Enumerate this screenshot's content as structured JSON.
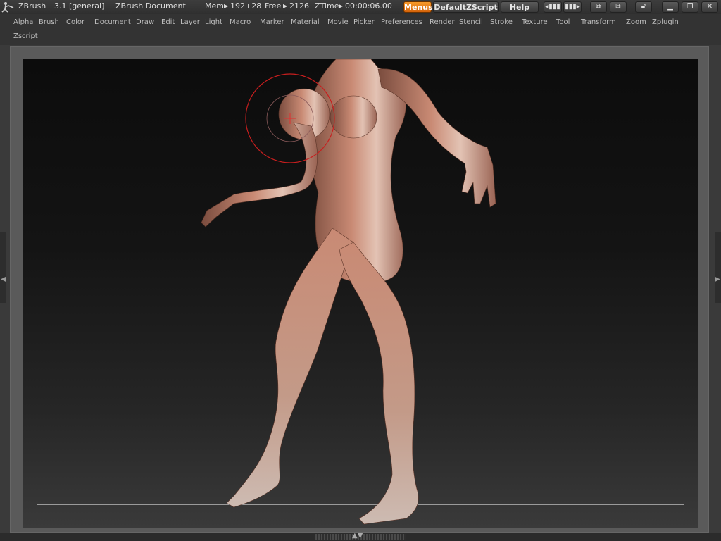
{
  "app": {
    "name": "ZBrush",
    "version": "3.1 [general]",
    "document_title": "ZBrush Document",
    "mem_label": "Mem",
    "mem_value": "192+28",
    "free_label": "Free",
    "free_value": "2126",
    "ztime_label": "ZTime",
    "ztime_value": "00:00:06.00"
  },
  "titlebar": {
    "menus_label": "Menus",
    "script_label": "DefaultZScript",
    "help_label": "Help",
    "icons": [
      "layout-prev-icon",
      "layout-next-icon",
      "window-tile-icon",
      "window-cascade-icon",
      "lock-icon",
      "minimize-icon",
      "restore-icon",
      "close-icon"
    ],
    "accent_color": "#f08a1c"
  },
  "menubar": {
    "items": [
      "Alpha",
      "Brush",
      "Color",
      "Document",
      "Draw",
      "Edit",
      "Layer",
      "Light",
      "Macro",
      "Marker",
      "Material",
      "Movie",
      "Picker",
      "Preferences",
      "Render",
      "Stencil",
      "Stroke",
      "Texture",
      "Tool",
      "Transform",
      "Zoom",
      "Zplugin",
      "Zscript"
    ]
  },
  "canvas": {
    "subject": "3D female figure sculpt",
    "material_color": "#c98a74",
    "brush_cursor_color": "#c81e1e"
  }
}
